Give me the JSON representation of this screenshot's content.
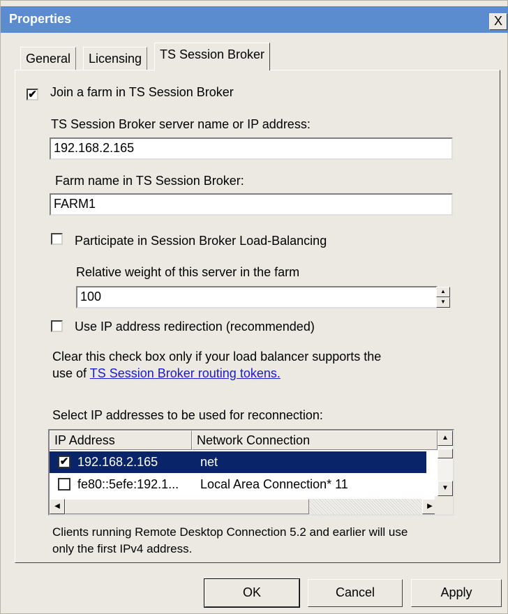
{
  "window": {
    "title": "Properties",
    "close_symbol": "X"
  },
  "tabs": [
    {
      "label": "General"
    },
    {
      "label": "Licensing"
    },
    {
      "label": "TS Session Broker"
    }
  ],
  "farm": {
    "join_checked": true,
    "join_label": "Join a farm in TS Session Broker",
    "server_label": "TS Session Broker server name or IP address:",
    "server_value": "192.168.2.165",
    "farm_name_label": "Farm name in TS Session Broker:",
    "farm_name_value": "FARM1"
  },
  "load_balancing": {
    "checked": false,
    "label": "Participate in Session Broker Load-Balancing",
    "weight_label": "Relative weight of this server in the farm",
    "weight_value": "100"
  },
  "redirection": {
    "checked": false,
    "label": "Use IP address redirection (recommended)",
    "note_line1": "Clear this check box only if your load balancer supports the",
    "note_prefix": "use of ",
    "note_link": "TS Session Broker routing tokens."
  },
  "ip_list": {
    "label": "Select IP addresses to be used for reconnection:",
    "columns": [
      "IP Address",
      "Network Connection"
    ],
    "rows": [
      {
        "checked": true,
        "ip": "192.168.2.165",
        "connection": "net",
        "selected": true
      },
      {
        "checked": false,
        "ip": "fe80::5efe:192.1...",
        "connection": "Local Area Connection* 11",
        "selected": false
      }
    ]
  },
  "footer_note": {
    "line1": "Clients running Remote Desktop Connection 5.2 and earlier will use",
    "line2": "only the first IPv4 address."
  },
  "buttons": {
    "ok": "OK",
    "cancel": "Cancel",
    "apply": "Apply"
  },
  "colors": {
    "titlebar": "#5b8ccf",
    "selection": "#0a246a",
    "link": "#1a1ad0",
    "face": "#ece9e3"
  },
  "icons": {
    "close": "close-icon",
    "check": "checkmark-icon",
    "up": "arrow-up-icon",
    "down": "arrow-down-icon",
    "left": "arrow-left-icon",
    "right": "arrow-right-icon"
  }
}
